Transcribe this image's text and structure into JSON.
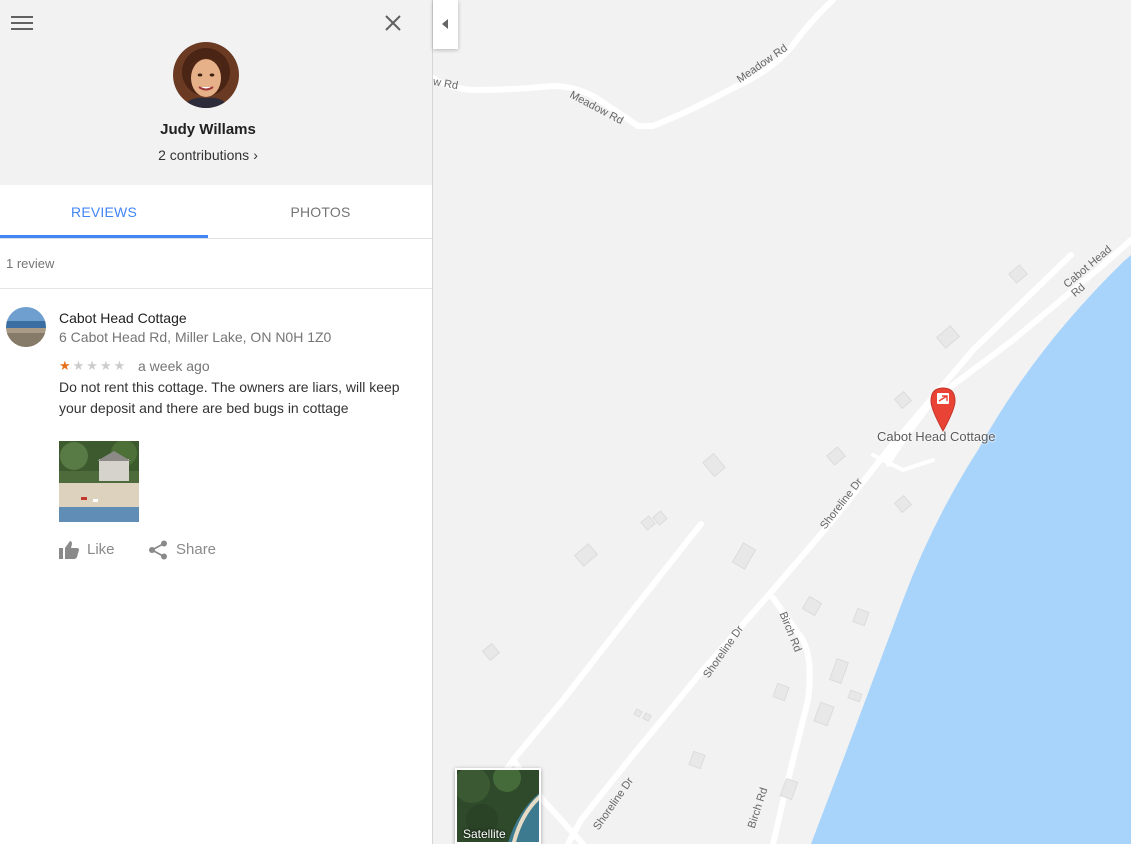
{
  "profile": {
    "name": "Judy Willams",
    "contributions": "2 contributions",
    "chevron": "›"
  },
  "tabs": [
    {
      "label": "REVIEWS",
      "active": true
    },
    {
      "label": "PHOTOS",
      "active": false
    }
  ],
  "review_count": "1 review",
  "review": {
    "place_name": "Cabot Head Cottage",
    "address": "6 Cabot Head Rd, Miller Lake, ON N0H 1Z0",
    "rating": 1,
    "max_rating": 5,
    "time": "a week ago",
    "text": "Do not rent this cottage. The owners are liars, will keep your deposit and there are bed bugs in cottage",
    "actions": {
      "like": "Like",
      "share": "Share"
    }
  },
  "map": {
    "pin_label": "Cabot Head Cottage",
    "satellite_label": "Satellite",
    "road_labels": [
      "w Rd",
      "Meadow Rd",
      "Meadow Rd",
      "Cabot Head Rd",
      "Shoreline Dr",
      "Shoreline Dr",
      "Shoreline Dr",
      "Birch Rd",
      "Birch Rd"
    ],
    "colors": {
      "land": "#f2f2f2",
      "water": "#a8d4fb",
      "road": "#ffffff",
      "building": "#e8e8e8",
      "pin": "#e94335"
    }
  },
  "colors": {
    "accent": "#4285f4",
    "star": "#e7711b"
  },
  "icons": [
    "menu-icon",
    "close-icon",
    "chevron-right-icon",
    "thumbs-up-icon",
    "share-icon",
    "collapse-arrow-icon",
    "map-pin-icon"
  ]
}
